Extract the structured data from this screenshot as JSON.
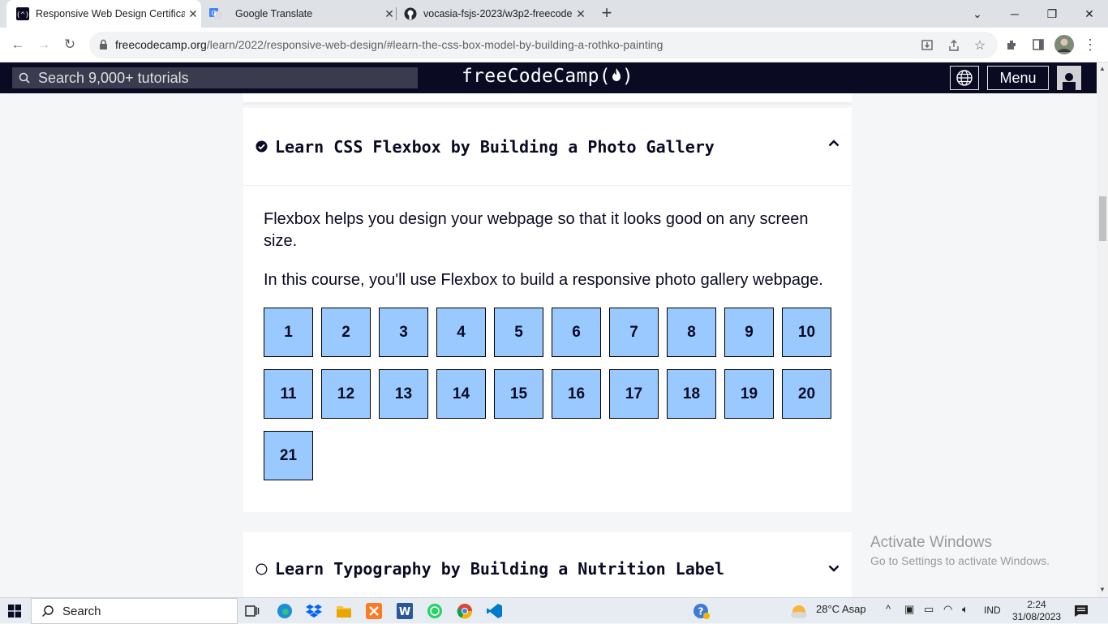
{
  "browser": {
    "tabs": [
      {
        "title": "Responsive Web Design Certificat",
        "active": true
      },
      {
        "title": "Google Translate",
        "active": false
      },
      {
        "title": "vocasia-fsjs-2023/w3p2-freecode",
        "active": false
      }
    ],
    "url_host": "freecodecamp.org",
    "url_path": "/learn/2022/responsive-web-design/#learn-the-css-box-model-by-building-a-rothko-painting"
  },
  "fcc_nav": {
    "search_placeholder": "Search 9,000+ tutorials",
    "logo": "freeCodeCamp(🔥)",
    "logo_text": "freeCodeCamp(",
    "logo_close": ")",
    "menu_label": "Menu"
  },
  "course_open": {
    "title": "Learn CSS Flexbox by Building a Photo Gallery",
    "completed": true,
    "description_1": "Flexbox helps you design your webpage so that it looks good on any screen size.",
    "description_2": "In this course, you'll use Flexbox to build a responsive photo gallery webpage.",
    "steps": [
      "1",
      "2",
      "3",
      "4",
      "5",
      "6",
      "7",
      "8",
      "9",
      "10",
      "11",
      "12",
      "13",
      "14",
      "15",
      "16",
      "17",
      "18",
      "19",
      "20",
      "21"
    ]
  },
  "course_next": {
    "title": "Learn Typography by Building a Nutrition Label",
    "completed": false
  },
  "watermark": {
    "line1": "Activate Windows",
    "line2": "Go to Settings to activate Windows."
  },
  "taskbar": {
    "search_label": "Search",
    "weather": "28°C  Asap",
    "lang": "IND",
    "time": "2:24",
    "date": "31/08/2023"
  }
}
